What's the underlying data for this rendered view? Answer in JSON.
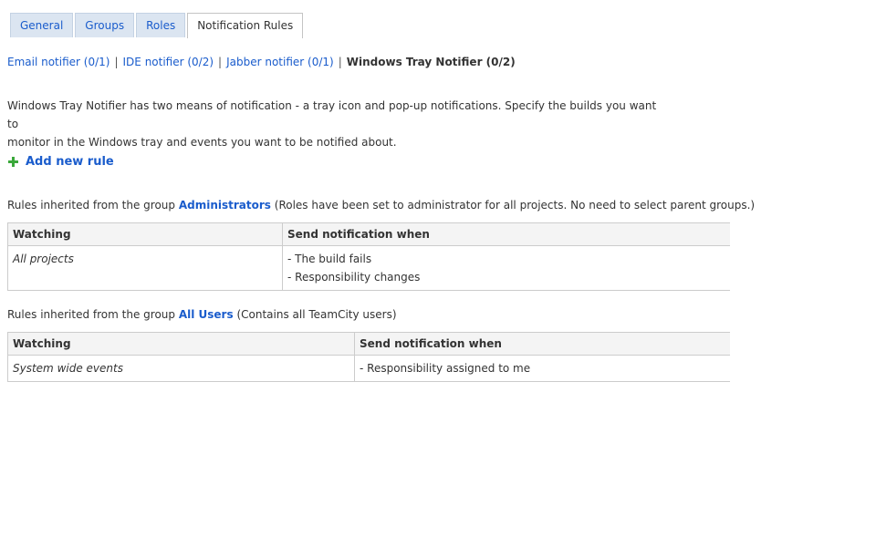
{
  "tabs": [
    {
      "label": "General",
      "active": false
    },
    {
      "label": "Groups",
      "active": false
    },
    {
      "label": "Roles",
      "active": false
    },
    {
      "label": "Notification Rules",
      "active": true
    }
  ],
  "notifiers": {
    "email": "Email notifier (0/1)",
    "ide": "IDE notifier (0/2)",
    "jabber": "Jabber notifier (0/1)",
    "separator": "|",
    "current": "Windows Tray Notifier (0/2)"
  },
  "description": {
    "line1": "Windows Tray Notifier has two means of notification - a tray icon and pop-up notifications. Specify the builds you want to",
    "line2": "monitor in the Windows tray and events you want to be notified about."
  },
  "add_rule": {
    "label": "Add new rule",
    "icon": "plus-icon",
    "icon_color": "#3aa83a"
  },
  "groups": [
    {
      "prefix": "Rules inherited from the group",
      "name": "Administrators",
      "note": "(Roles have been set to administrator for all projects. No need to select parent groups.)",
      "headers": {
        "watching": "Watching",
        "send": "Send notification when"
      },
      "rows": [
        {
          "watching": "All projects",
          "events": [
            "- The build fails",
            "- Responsibility changes"
          ]
        }
      ]
    },
    {
      "prefix": "Rules inherited from the group",
      "name": "All Users",
      "note": "(Contains all TeamCity users)",
      "headers": {
        "watching": "Watching",
        "send": "Send notification when"
      },
      "rows": [
        {
          "watching": "System wide events",
          "events": [
            "- Responsibility assigned to me"
          ]
        }
      ]
    }
  ],
  "colors": {
    "link": "#1a5ccc",
    "tab_bg": "#dbe5f1",
    "header_bg": "#f4f4f4",
    "border": "#cccccc"
  }
}
